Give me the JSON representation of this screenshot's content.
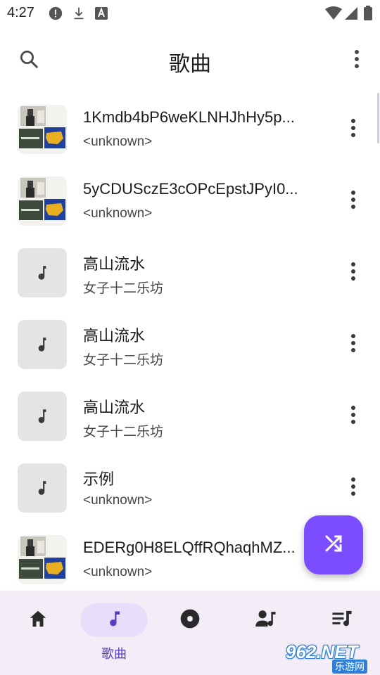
{
  "status_bar": {
    "time": "4:27",
    "icons": [
      "alert-circle-icon",
      "download-icon",
      "font-a-icon",
      "wifi-icon",
      "signal-icon",
      "battery-icon"
    ]
  },
  "app_bar": {
    "title": "歌曲",
    "search_icon": "search-icon",
    "menu_icon": "more-vertical-icon"
  },
  "songs": [
    {
      "title": "1Kmdb4bP6weKLNHJhHy5p...",
      "artist": "<unknown>",
      "art": "photo"
    },
    {
      "title": "5yCDUSczE3cOPcEpstJPyI0...",
      "artist": "<unknown>",
      "art": "photo"
    },
    {
      "title": "高山流水",
      "artist": "女子十二乐坊",
      "art": "music-note"
    },
    {
      "title": "高山流水",
      "artist": "女子十二乐坊",
      "art": "music-note"
    },
    {
      "title": "高山流水",
      "artist": "女子十二乐坊",
      "art": "music-note"
    },
    {
      "title": "示例",
      "artist": "<unknown>",
      "art": "music-note"
    },
    {
      "title": "EDERg0H8ELQffRQhaqhMZ...",
      "artist": "<unknown>",
      "art": "photo"
    }
  ],
  "fab": {
    "icon": "shuffle-icon"
  },
  "bottom_nav": {
    "items": [
      {
        "icon": "home-icon",
        "label": "",
        "active": false
      },
      {
        "icon": "music-note-icon",
        "label": "歌曲",
        "active": true
      },
      {
        "icon": "album-icon",
        "label": "",
        "active": false
      },
      {
        "icon": "artist-icon",
        "label": "",
        "active": false
      },
      {
        "icon": "playlist-icon",
        "label": "",
        "active": false
      }
    ]
  },
  "watermark": {
    "main": "962.NET",
    "sub": "乐游网"
  },
  "colors": {
    "accent": "#7c4dff",
    "nav_background": "#f3edf7",
    "nav_active_pill": "#e8defc",
    "thumb_placeholder": "#e4e4e4"
  }
}
